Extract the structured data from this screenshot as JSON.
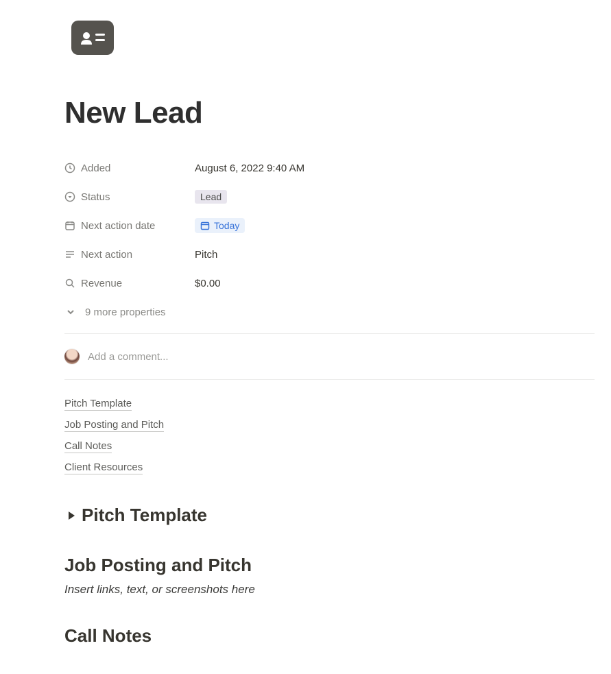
{
  "title": "New Lead",
  "properties": {
    "added": {
      "label": "Added",
      "value": "August 6, 2022 9:40 AM"
    },
    "status": {
      "label": "Status",
      "value": "Lead"
    },
    "next_action_date": {
      "label": "Next action date",
      "value": "Today"
    },
    "next_action": {
      "label": "Next action",
      "value": "Pitch"
    },
    "revenue": {
      "label": "Revenue",
      "value": "$0.00"
    }
  },
  "more_properties": "9 more properties",
  "comment_placeholder": "Add a comment...",
  "toc": [
    "Pitch Template",
    "Job Posting and Pitch",
    "Call Notes",
    "Client Resources"
  ],
  "sections": {
    "pitch_template": "Pitch Template",
    "job_posting": "Job Posting and Pitch",
    "job_posting_hint": "Insert links, text, or screenshots here",
    "call_notes": "Call Notes"
  }
}
